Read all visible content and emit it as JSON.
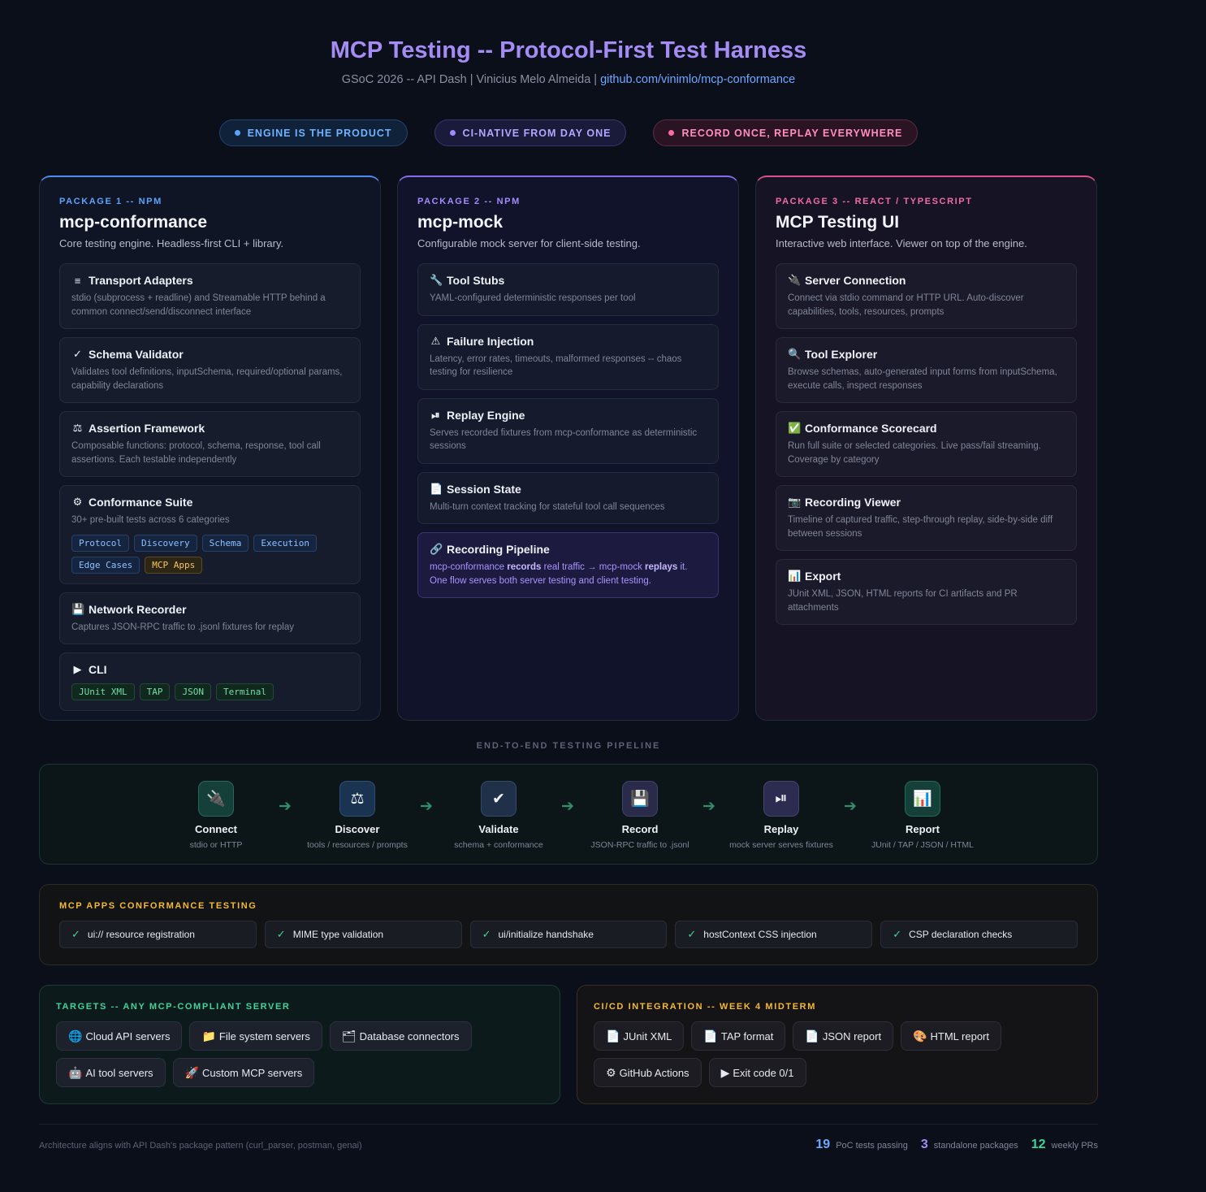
{
  "header": {
    "title": "MCP Testing -- Protocol-First Test Harness",
    "subtitle_prefix": "GSoC 2026 -- API Dash | Vinicius Melo Almeida | ",
    "subtitle_link": "github.com/vinimlo/mcp-conformance"
  },
  "pills": [
    {
      "label": "ENGINE IS THE PRODUCT"
    },
    {
      "label": "CI-NATIVE FROM DAY ONE"
    },
    {
      "label": "RECORD ONCE, REPLAY EVERYWHERE"
    }
  ],
  "packages": [
    {
      "tag": "PACKAGE 1 -- NPM",
      "name": "mcp-conformance",
      "desc": "Core testing engine. Headless-first CLI + library.",
      "items": [
        {
          "icon": "≡",
          "title": "Transport Adapters",
          "desc": "stdio (subprocess + readline) and Streamable HTTP behind a common connect/send/disconnect interface"
        },
        {
          "icon": "✓",
          "title": "Schema Validator",
          "desc": "Validates tool definitions, inputSchema, required/optional params, capability declarations"
        },
        {
          "icon": "⚖",
          "title": "Assertion Framework",
          "desc": "Composable functions: protocol, schema, response, tool call assertions. Each testable independently"
        },
        {
          "icon": "⚙",
          "title": "Conformance Suite",
          "desc": "30+ pre-built tests across 6 categories",
          "tags": [
            "Protocol",
            "Discovery",
            "Schema",
            "Execution",
            "Edge Cases",
            "MCP Apps"
          ]
        },
        {
          "icon": "💾",
          "title": "Network Recorder",
          "desc": "Captures JSON-RPC traffic to .jsonl fixtures for replay"
        },
        {
          "icon": "▶",
          "title": "CLI",
          "tags": [
            "JUnit XML",
            "TAP",
            "JSON",
            "Terminal"
          ]
        }
      ]
    },
    {
      "tag": "PACKAGE 2 -- NPM",
      "name": "mcp-mock",
      "desc": "Configurable mock server for client-side testing.",
      "items": [
        {
          "icon": "🔧",
          "title": "Tool Stubs",
          "desc": "YAML-configured deterministic responses per tool"
        },
        {
          "icon": "⚠",
          "title": "Failure Injection",
          "desc": "Latency, error rates, timeouts, malformed responses -- chaos testing for resilience"
        },
        {
          "icon": "⏯",
          "title": "Replay Engine",
          "desc": "Serves recorded fixtures from mcp-conformance as deterministic sessions"
        },
        {
          "icon": "📄",
          "title": "Session State",
          "desc": "Multi-turn context tracking for stateful tool call sequences"
        },
        {
          "icon": "🔗",
          "title": "Recording Pipeline",
          "desc_a": "mcp-conformance ",
          "desc_b": "records",
          "desc_c": " real traffic → mcp-mock ",
          "desc_d": "replays",
          "desc_e": " it.",
          "desc_f": "One flow serves both server testing and client testing."
        }
      ]
    },
    {
      "tag": "PACKAGE 3 -- REACT / TYPESCRIPT",
      "name": "MCP Testing UI",
      "desc": "Interactive web interface. Viewer on top of the engine.",
      "items": [
        {
          "icon": "🔌",
          "title": "Server Connection",
          "desc": "Connect via stdio command or HTTP URL. Auto-discover capabilities, tools, resources, prompts"
        },
        {
          "icon": "🔍",
          "title": "Tool Explorer",
          "desc": "Browse schemas, auto-generated input forms from inputSchema, execute calls, inspect responses"
        },
        {
          "icon": "✅",
          "title": "Conformance Scorecard",
          "desc": "Run full suite or selected categories. Live pass/fail streaming. Coverage by category"
        },
        {
          "icon": "📷",
          "title": "Recording Viewer",
          "desc": "Timeline of captured traffic, step-through replay, side-by-side diff between sessions"
        },
        {
          "icon": "📊",
          "title": "Export",
          "desc": "JUnit XML, JSON, HTML reports for CI artifacts and PR attachments"
        }
      ]
    }
  ],
  "pipeline": {
    "label": "END-TO-END TESTING PIPELINE",
    "stages": [
      {
        "icon": "🔌",
        "name": "Connect",
        "sub": "stdio or HTTP"
      },
      {
        "icon": "⚖",
        "name": "Discover",
        "sub": "tools / resources / prompts"
      },
      {
        "icon": "✔",
        "name": "Validate",
        "sub": "schema + conformance"
      },
      {
        "icon": "💾",
        "name": "Record",
        "sub": "JSON-RPC traffic to .jsonl"
      },
      {
        "icon": "⏯",
        "name": "Replay",
        "sub": "mock server serves fixtures"
      },
      {
        "icon": "📊",
        "name": "Report",
        "sub": "JUnit / TAP / JSON / HTML"
      }
    ]
  },
  "apps": {
    "title": "MCP APPS CONFORMANCE TESTING",
    "checks": [
      "ui:// resource registration",
      "MIME type validation",
      "ui/initialize handshake",
      "hostContext CSS injection",
      "CSP declaration checks"
    ]
  },
  "targets": {
    "title": "TARGETS -- ANY MCP-COMPLIANT SERVER",
    "chips": [
      {
        "icon": "🌐",
        "label": "Cloud API servers"
      },
      {
        "icon": "📁",
        "label": "File system servers"
      },
      {
        "icon": "🗂",
        "label": "Database connectors"
      },
      {
        "icon": "🤖",
        "label": "AI tool servers"
      },
      {
        "icon": "🚀",
        "label": "Custom MCP servers"
      }
    ]
  },
  "cicd": {
    "title": "CI/CD INTEGRATION -- WEEK 4 MIDTERM",
    "chips": [
      {
        "icon": "📄",
        "label": "JUnit XML"
      },
      {
        "icon": "📄",
        "label": "TAP format"
      },
      {
        "icon": "📄",
        "label": "JSON report"
      },
      {
        "icon": "🎨",
        "label": "HTML report"
      },
      {
        "icon": "⚙",
        "label": "GitHub Actions"
      },
      {
        "icon": "▶",
        "label": "Exit code 0/1"
      }
    ]
  },
  "footer": {
    "note": "Architecture aligns with API Dash's package pattern (curl_parser, postman, genai)",
    "stats": [
      {
        "n": "19",
        "label": "PoC tests passing",
        "color": "#6ea8ff"
      },
      {
        "n": "3",
        "label": "standalone packages",
        "color": "#a58cf5"
      },
      {
        "n": "12",
        "label": "weekly PRs",
        "color": "#3fd49a"
      }
    ]
  },
  "colors": {
    "background": "#0b0f1a",
    "blue_accent": "#4e8cf0",
    "purple_accent": "#8a6cf0",
    "pink_accent": "#e0508e",
    "green_accent": "#3fd49a",
    "gold_accent": "#f5b933"
  }
}
